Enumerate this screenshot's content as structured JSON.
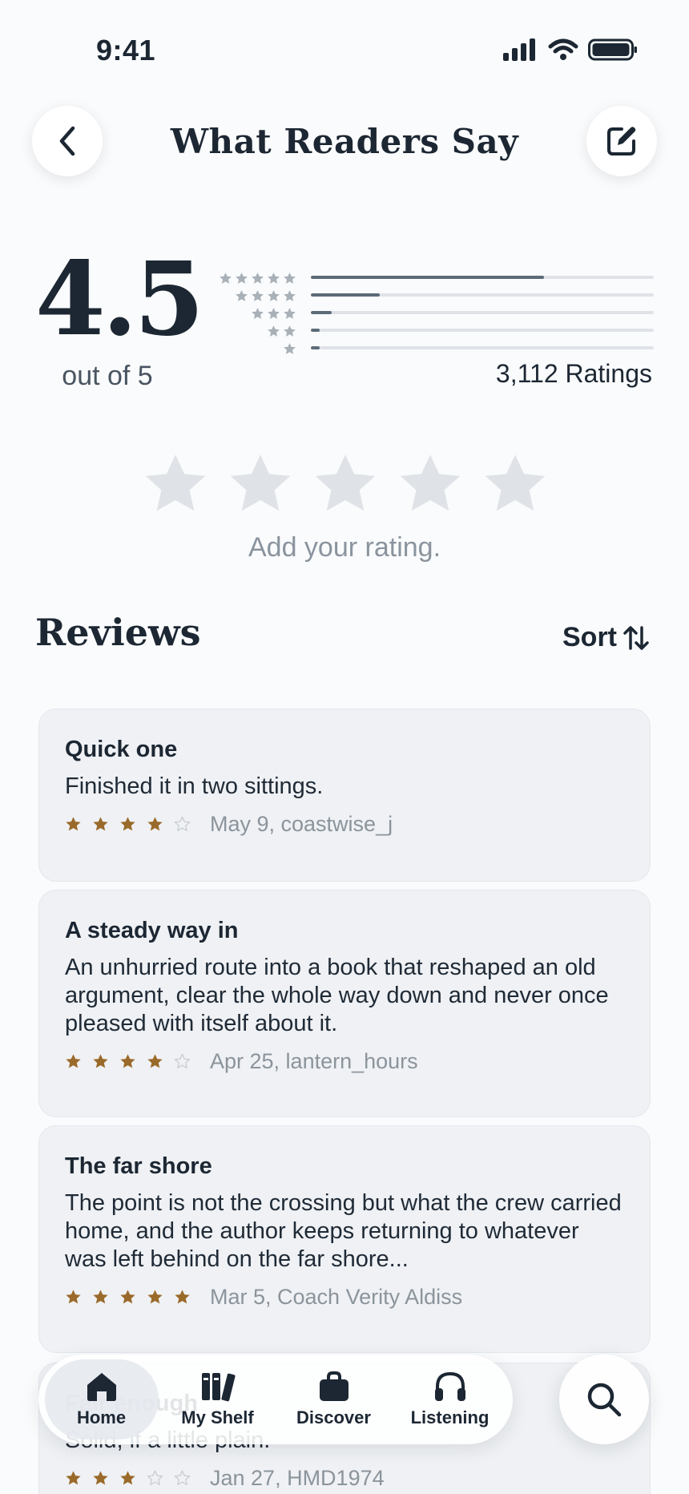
{
  "status": {
    "time": "9:41"
  },
  "header": {
    "title": "What Readers Say",
    "back_icon": "chevron-left-icon",
    "edit_icon": "edit-icon"
  },
  "summary": {
    "average": "4.5",
    "out_of": "out of 5",
    "ratings_count": "3,112 Ratings",
    "distribution": [
      {
        "stars": 5,
        "fraction": 0.68
      },
      {
        "stars": 4,
        "fraction": 0.2
      },
      {
        "stars": 3,
        "fraction": 0.06
      },
      {
        "stars": 2,
        "fraction": 0.025
      },
      {
        "stars": 1,
        "fraction": 0.025
      }
    ]
  },
  "add_rating": {
    "prompt": "Add your rating."
  },
  "reviews_section": {
    "heading": "Reviews",
    "sort_label": "Sort"
  },
  "reviews": [
    {
      "title": "Quick one",
      "body": "Finished it in two sittings.",
      "rating": 4,
      "meta": "May 9, coastwise_j"
    },
    {
      "title": "A steady way in",
      "body": "An unhurried route into a book that reshaped an old argument, clear the whole way down and never once pleased with itself about it.",
      "rating": 4,
      "meta": "Apr 25, lantern_hours"
    },
    {
      "title": "The far shore",
      "body": "The point is not the crossing but what the crew carried home, and the author keeps returning to whatever was left behind on the far shore...",
      "rating": 5,
      "meta": "Mar 5, Coach Verity Aldiss"
    },
    {
      "title": "Fair enough",
      "body": "Solid, if a little plain.",
      "rating": 3,
      "meta": "Jan 27, HMD1974"
    }
  ],
  "tab_bar": {
    "tabs": [
      {
        "label": "Home",
        "icon": "home-icon",
        "active": true
      },
      {
        "label": "My Shelf",
        "icon": "books-icon",
        "active": false
      },
      {
        "label": "Discover",
        "icon": "bag-icon",
        "active": false
      },
      {
        "label": "Listening",
        "icon": "headphones-icon",
        "active": false
      }
    ],
    "search_icon": "search-icon"
  },
  "colors": {
    "accent_star": "#9a6a2a",
    "empty_star": "#dfe2e6",
    "hist_star": "#a8b0b8",
    "text_primary": "#1c2733"
  }
}
